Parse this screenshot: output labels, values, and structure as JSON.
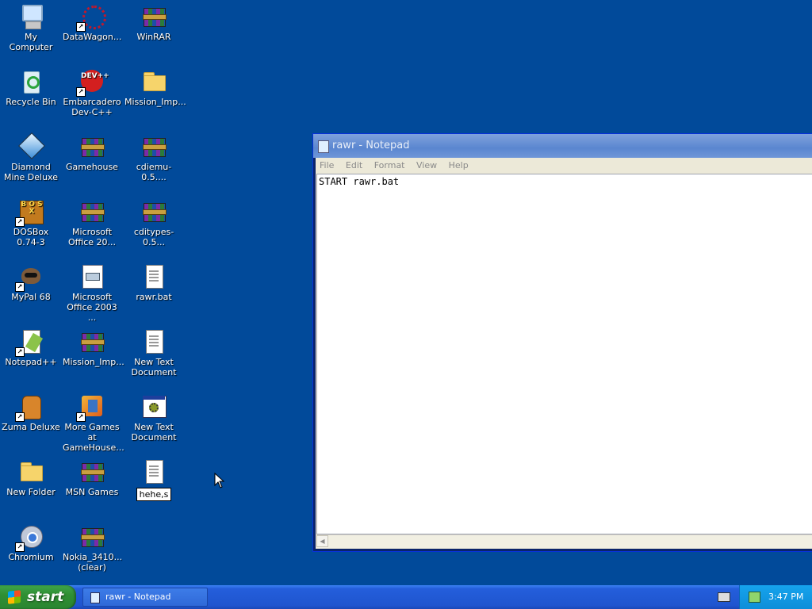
{
  "desktop": {
    "col1": [
      {
        "label": "My Computer",
        "icon": "computer-icon"
      },
      {
        "label": "Recycle Bin",
        "icon": "recycle-bin-icon"
      },
      {
        "label": "Diamond Mine Deluxe",
        "icon": "diamond-icon"
      },
      {
        "label": "DOSBox 0.74-3",
        "icon": "dosbox-icon"
      },
      {
        "label": "MyPal 68",
        "icon": "raccoon-icon"
      },
      {
        "label": "Notepad++",
        "icon": "notepad-plus-icon"
      },
      {
        "label": "Zuma Deluxe",
        "icon": "zuma-icon"
      },
      {
        "label": "New Folder",
        "icon": "folder-icon"
      },
      {
        "label": "Chromium",
        "icon": "chromium-icon"
      }
    ],
    "col2": [
      {
        "label": "DataWagon...",
        "icon": "datawagon-icon"
      },
      {
        "label": "Embarcadero Dev-C++",
        "icon": "dev-cpp-icon"
      },
      {
        "label": "Gamehouse",
        "icon": "winrar-archive-icon"
      },
      {
        "label": "Microsoft Office 20...",
        "icon": "winrar-archive-icon"
      },
      {
        "label": "Microsoft Office 2003 ...",
        "icon": "document-icon"
      },
      {
        "label": "Mission_Imp...",
        "icon": "winrar-archive-icon"
      },
      {
        "label": "More Games at GameHouse...",
        "icon": "gamehouse-icon"
      },
      {
        "label": "MSN Games",
        "icon": "winrar-archive-icon"
      },
      {
        "label": "Nokia_3410... (clear)",
        "icon": "winrar-archive-icon"
      }
    ],
    "col3": [
      {
        "label": "WinRAR",
        "icon": "winrar-archive-icon"
      },
      {
        "label": "Mission_Imp...",
        "icon": "folder-icon"
      },
      {
        "label": "cdiemu-0.5....",
        "icon": "winrar-archive-icon"
      },
      {
        "label": "cditypes-0.5...",
        "icon": "winrar-archive-icon"
      },
      {
        "label": "rawr.bat",
        "icon": "text-file-icon"
      },
      {
        "label": "New Text Document",
        "icon": "text-file-icon"
      },
      {
        "label": "New Text Document",
        "icon": "application-icon"
      },
      {
        "label": "hehe,s",
        "icon": "text-file-icon"
      }
    ],
    "dev_icon_text": "DEV++",
    "dosbox_icon_text": "B O S X"
  },
  "notepad": {
    "title": "rawr - Notepad",
    "menu": [
      "File",
      "Edit",
      "Format",
      "View",
      "Help"
    ],
    "content": "START rawr.bat",
    "scroll_left": "◀"
  },
  "taskbar": {
    "start_label": "start",
    "task_label": "rawr - Notepad",
    "clock": "3:47 PM"
  },
  "colors": {
    "desktop": "#014a9a",
    "taskbar": "#245edb",
    "start": "#2f8f33",
    "tray": "#0d8ed9"
  }
}
